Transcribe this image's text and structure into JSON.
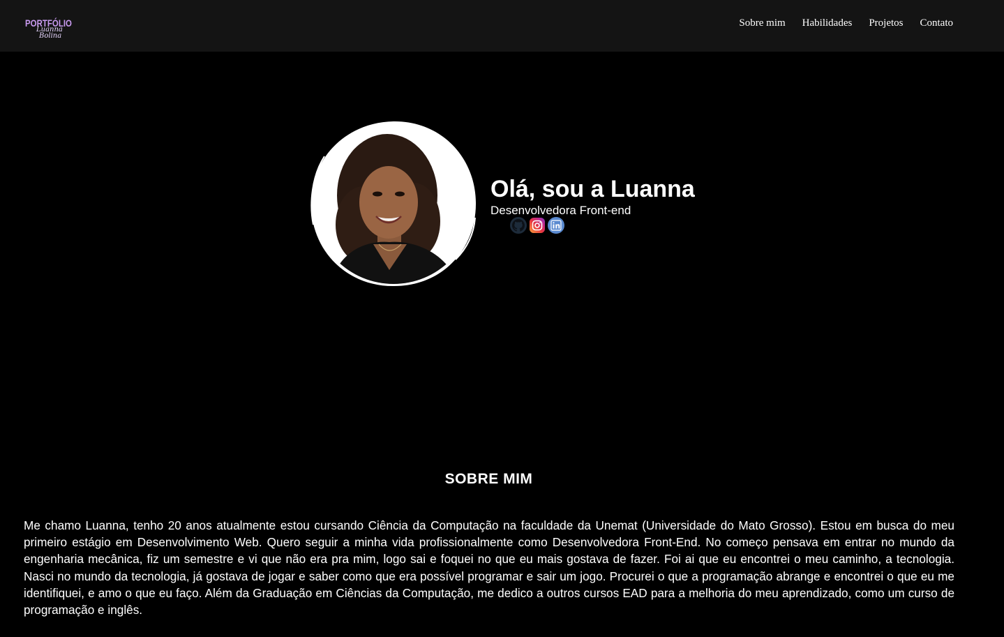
{
  "header": {
    "logo": {
      "main": "PORTFÓLIO",
      "signature_first": "Luanna",
      "signature_last": "Bolina"
    },
    "nav": [
      {
        "label": "Sobre mim"
      },
      {
        "label": "Habilidades"
      },
      {
        "label": "Projetos"
      },
      {
        "label": "Contato"
      }
    ]
  },
  "hero": {
    "title": "Olá, sou a Luanna",
    "subtitle": "Desenvolvedora Front-end",
    "socials": [
      {
        "icon": "github-icon"
      },
      {
        "icon": "instagram-icon"
      },
      {
        "icon": "linkedin-icon"
      }
    ]
  },
  "about": {
    "heading": "SOBRE MIM",
    "text": "Me chamo Luanna, tenho 20 anos atualmente estou cursando Ciência da Computação na faculdade da Unemat (Universidade do Mato Grosso). Estou em busca do meu primeiro estágio em Desenvolvimento Web. Quero seguir a minha vida profissionalmente como Desenvolvedora Front-End. No começo pensava em entrar no mundo da engenharia mecânica, fiz um semestre e vi que não era pra mim, logo sai e foquei no que eu mais gostava de fazer. Foi ai que eu encontrei o meu caminho, a tecnologia. Nasci no mundo da tecnologia, já gostava de jogar e saber como que era possível programar e sair um jogo. Procurei o que a programação abrange e encontrei o que eu me identifiquei, e amo o que eu faço. Além da Graduação em Ciências da Computação, me dedico a outros cursos EAD para a melhoria do meu aprendizado, como um curso de programação e inglês."
  },
  "colors": {
    "page_background": "#000000",
    "navbar_background": "#141414",
    "logo_accent": "#c99bf0",
    "text": "#ffffff"
  }
}
